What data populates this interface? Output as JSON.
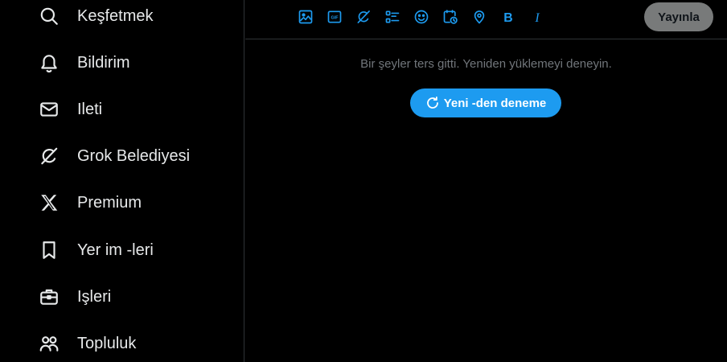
{
  "sidebar": {
    "items": [
      {
        "label": "Keşfetmek",
        "icon": "search-icon"
      },
      {
        "label": "Bildirim",
        "icon": "bell-icon"
      },
      {
        "label": "Ileti",
        "icon": "mail-icon"
      },
      {
        "label": "Grok Belediyesi",
        "icon": "grok-icon"
      },
      {
        "label": "Premium",
        "icon": "x-logo-icon"
      },
      {
        "label": "Yer im -leri",
        "icon": "bookmark-icon"
      },
      {
        "label": "Işleri",
        "icon": "briefcase-icon"
      },
      {
        "label": "Topluluk",
        "icon": "people-icon"
      }
    ]
  },
  "toolbar": {
    "tools": [
      "image-icon",
      "gif-icon",
      "grok-icon",
      "poll-icon",
      "emoji-icon",
      "schedule-icon",
      "location-icon",
      "bold-icon",
      "italic-icon"
    ],
    "gif_text": "GIF",
    "bold_text": "B",
    "italic_text": "I",
    "publish_label": "Yayınla"
  },
  "main": {
    "error_message": "Bir şeyler ters gitti. Yeniden yüklemeyi deneyin.",
    "retry_label": "Yeni -den deneme"
  },
  "colors": {
    "accent": "#1d9bf0",
    "text": "#e7e9ea",
    "muted": "#71767b",
    "border": "#2f3336",
    "publish_bg": "#787a7a"
  }
}
